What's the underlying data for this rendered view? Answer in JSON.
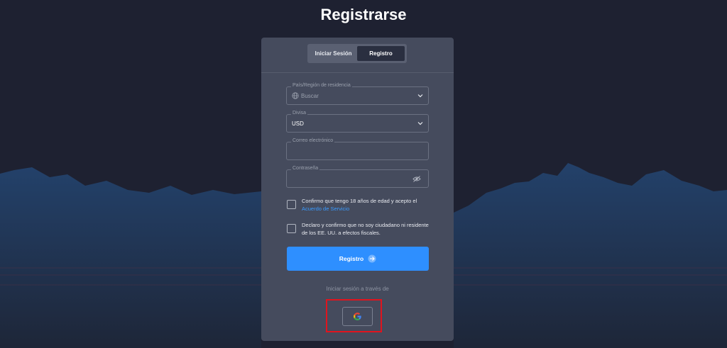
{
  "page": {
    "title": "Registrarse"
  },
  "tabs": [
    {
      "label": "Iniciar Sesión",
      "active": false
    },
    {
      "label": "Registro",
      "active": true
    }
  ],
  "form": {
    "country": {
      "label": "País/Región de residencia",
      "placeholder": "Buscar",
      "icon": "globe-icon"
    },
    "currency": {
      "label": "Divisa",
      "value": "USD"
    },
    "email": {
      "label": "Correo electrónico",
      "value": ""
    },
    "password": {
      "label": "Contraseña",
      "value": "",
      "icon": "eye-slash-icon"
    }
  },
  "checkboxes": {
    "age": {
      "text": "Confirmo que tengo 18 años de edad y acepto el",
      "link": "Acuerdo de Servicio",
      "checked": false
    },
    "tax": {
      "text": "Declaro y confirmo que no soy ciudadano ni residente de los EE. UU. a efectos fiscales.",
      "checked": false
    }
  },
  "register_button": {
    "label": "Registro",
    "icon": "arrow-right-circle-icon"
  },
  "social": {
    "text": "Iniciar sesión a través de",
    "providers": [
      {
        "name": "google-icon"
      }
    ]
  },
  "colors": {
    "background": "#1e2131",
    "card": "#454b5d",
    "accent": "#2e8fff",
    "link": "#3a9bff",
    "highlight": "#e0141e"
  }
}
